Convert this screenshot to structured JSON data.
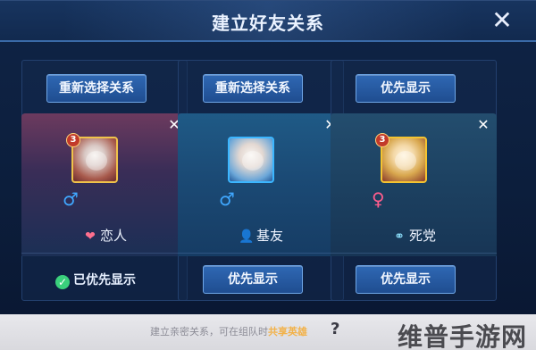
{
  "header": {
    "title": "建立好友关系",
    "close_icon": "close-icon"
  },
  "columns": [
    {
      "top_button": "重新选择关系",
      "avatar": {
        "level": "3",
        "theme": "lover"
      },
      "gender": {
        "symbol": "♂",
        "type": "male"
      },
      "relation": {
        "label": "恋人",
        "icon": "heart-icon"
      },
      "bottom": {
        "type": "status",
        "label": "已优先显示"
      }
    },
    {
      "top_button": "重新选择关系",
      "avatar": {
        "level": "",
        "theme": "bestie"
      },
      "gender": {
        "symbol": "♂",
        "type": "male"
      },
      "relation": {
        "label": "基友",
        "icon": "person-icon"
      },
      "bottom": {
        "type": "button",
        "label": "优先显示"
      }
    },
    {
      "top_button": "优先显示",
      "avatar": {
        "level": "3",
        "theme": "dead"
      },
      "gender": {
        "symbol": "♀",
        "type": "female"
      },
      "relation": {
        "label": "死党",
        "icon": "tie-icon"
      },
      "bottom": {
        "type": "button",
        "label": "优先显示"
      }
    }
  ],
  "footer": {
    "text_prefix": "建立亲密关系，可在组队时",
    "text_highlight": "共享英雄",
    "help": "?",
    "watermark": "维普手游网"
  },
  "colors": {
    "accent_blue": "#2f68b4",
    "male": "#40a8ff",
    "female": "#ff5d8d",
    "highlight": "#f2b24a"
  }
}
